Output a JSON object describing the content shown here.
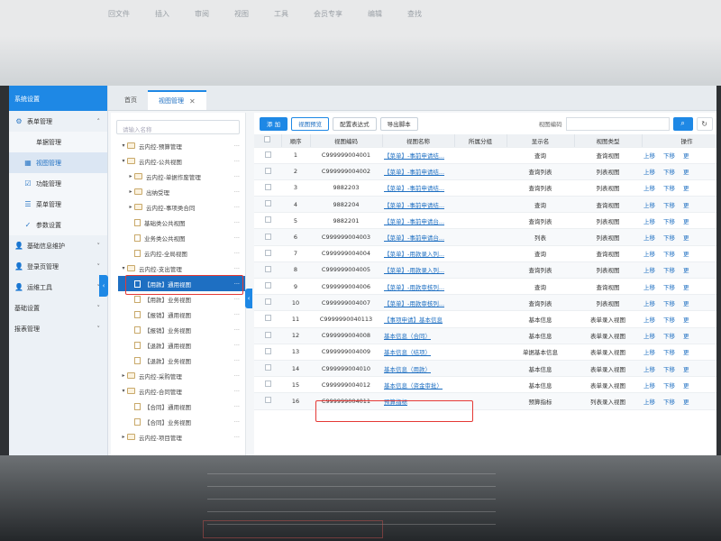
{
  "screen_title": "系统设置",
  "menu": [
    {
      "label": "表单管理",
      "icon": "gear-icon",
      "expanded": true,
      "chevron": "^"
    },
    {
      "label": "单据管理",
      "sub": true
    },
    {
      "label": "视图管理",
      "sub": true,
      "icon": "grid-icon",
      "active": true
    },
    {
      "label": "功能管理",
      "sub": true,
      "icon": "checkbox-icon"
    },
    {
      "label": "菜单管理",
      "sub": true,
      "icon": "menu-icon"
    },
    {
      "label": "参数设置",
      "sub": true,
      "icon": "check-icon"
    },
    {
      "label": "基础信息维护",
      "icon": "user-icon",
      "chevron": "v"
    },
    {
      "label": "登录页管理",
      "icon": "user-icon",
      "chevron": "v"
    },
    {
      "label": "运维工具",
      "icon": "user-icon",
      "chevron": "v"
    },
    {
      "label": "基础设置",
      "chevron": "v"
    },
    {
      "label": "报表管理",
      "chevron": "v"
    }
  ],
  "tabs": [
    {
      "label": "首页",
      "active": false
    },
    {
      "label": "视图管理",
      "active": true
    }
  ],
  "tree": {
    "search_placeholder": "请输入名称",
    "rows": [
      {
        "label": "云内控-预算管理",
        "level": 1,
        "type": "folder",
        "arrow": "v"
      },
      {
        "label": "云内控-公共视图",
        "level": 1,
        "type": "folder",
        "arrow": "v"
      },
      {
        "label": "云内控-单据作废管理",
        "level": 2,
        "type": "folder",
        "arrow": ">"
      },
      {
        "label": "出纳受理",
        "level": 2,
        "type": "folder",
        "arrow": ">"
      },
      {
        "label": "云内控-事项类合同",
        "level": 2,
        "type": "folder",
        "arrow": ">"
      },
      {
        "label": "基础类公共视图",
        "level": 2,
        "type": "doc"
      },
      {
        "label": "业务类公共视图",
        "level": 2,
        "type": "doc"
      },
      {
        "label": "云内控-全局视图",
        "level": 2,
        "type": "doc"
      },
      {
        "label": "云内控-支出管理",
        "level": 1,
        "type": "folder",
        "arrow": "v"
      },
      {
        "label": "【用款】通用视图",
        "level": 2,
        "type": "doc",
        "selected": true
      },
      {
        "label": "【用款】业务视图",
        "level": 2,
        "type": "doc"
      },
      {
        "label": "【报销】通用视图",
        "level": 2,
        "type": "doc"
      },
      {
        "label": "【报销】业务视图",
        "level": 2,
        "type": "doc"
      },
      {
        "label": "【退款】通用视图",
        "level": 2,
        "type": "doc"
      },
      {
        "label": "【退款】业务视图",
        "level": 2,
        "type": "doc"
      },
      {
        "label": "云内控-采购管理",
        "level": 1,
        "type": "folder",
        "arrow": ">"
      },
      {
        "label": "云内控-合同管理",
        "level": 1,
        "type": "folder",
        "arrow": "v"
      },
      {
        "label": "【合同】通用视图",
        "level": 2,
        "type": "doc"
      },
      {
        "label": "【合同】业务视图",
        "level": 2,
        "type": "doc"
      },
      {
        "label": "云内控-项目管理",
        "level": 1,
        "type": "folder",
        "arrow": ">"
      }
    ]
  },
  "toolbar": {
    "add_label": "添 加",
    "view_preview_label": "视图预览",
    "config_expr_label": "配置表达式",
    "export_script_label": "导出脚本",
    "search_label": "视图编码",
    "search_value": ""
  },
  "table": {
    "columns": [
      "",
      "顺序",
      "视图编码",
      "视图名称",
      "所属分组",
      "显示名",
      "视图类型",
      "操作"
    ],
    "op_labels": [
      "上移",
      "下移",
      "更"
    ],
    "rows": [
      {
        "order": "1",
        "code": "C999999004001",
        "name": "【菜单】-事前申请结...",
        "group": "",
        "display": "查询",
        "type": "查询视图"
      },
      {
        "order": "2",
        "code": "C999999004002",
        "name": "【菜单】-事前申请结...",
        "group": "",
        "display": "查询列表",
        "type": "列表视图"
      },
      {
        "order": "3",
        "code": "9882203",
        "name": "【菜单】-事前申请结...",
        "group": "",
        "display": "查询列表",
        "type": "列表视图"
      },
      {
        "order": "4",
        "code": "9882204",
        "name": "【菜单】-事前申请结...",
        "group": "",
        "display": "查询",
        "type": "查询视图"
      },
      {
        "order": "5",
        "code": "9882201",
        "name": "【菜单】-事前申请台...",
        "group": "",
        "display": "查询列表",
        "type": "列表视图"
      },
      {
        "order": "6",
        "code": "C999999004003",
        "name": "【菜单】-事前申请台...",
        "group": "",
        "display": "列表",
        "type": "列表视图"
      },
      {
        "order": "7",
        "code": "C999999004004",
        "name": "【菜单】-用款录入列...",
        "group": "",
        "display": "查询",
        "type": "查询视图"
      },
      {
        "order": "8",
        "code": "C999999004005",
        "name": "【菜单】-用款录入列...",
        "group": "",
        "display": "查询列表",
        "type": "列表视图"
      },
      {
        "order": "9",
        "code": "C999999004006",
        "name": "【菜单】-用款审核列...",
        "group": "",
        "display": "查询",
        "type": "查询视图"
      },
      {
        "order": "10",
        "code": "C999999004007",
        "name": "【菜单】-用款审核列...",
        "group": "",
        "display": "查询列表",
        "type": "列表视图"
      },
      {
        "order": "11",
        "code": "C9999990040113",
        "name": "【事项申请】基本信息",
        "group": "",
        "display": "基本信息",
        "type": "表单录入视图"
      },
      {
        "order": "12",
        "code": "C999999004008",
        "name": "基本信息（合同）",
        "group": "",
        "display": "基本信息",
        "type": "表单录入视图"
      },
      {
        "order": "13",
        "code": "C999999004009",
        "name": "基本信息（结项）",
        "group": "",
        "display": "单据基本信息",
        "type": "表单录入视图"
      },
      {
        "order": "14",
        "code": "C999999004010",
        "name": "基本信息（用款）",
        "group": "",
        "display": "基本信息",
        "type": "表单录入视图"
      },
      {
        "order": "15",
        "code": "C999999004012",
        "name": "基本信息（资金审批）",
        "group": "",
        "display": "基本信息",
        "type": "表单录入视图"
      },
      {
        "order": "16",
        "code": "C999999004011",
        "name": "预算指标",
        "group": "",
        "display": "预算指标",
        "type": "列表录入视图"
      }
    ]
  },
  "photo_overlay": {
    "faint_menu": [
      "回文件",
      "插入",
      "审阅",
      "视图",
      "工具",
      "会员专享",
      "编辑",
      "查找"
    ]
  }
}
